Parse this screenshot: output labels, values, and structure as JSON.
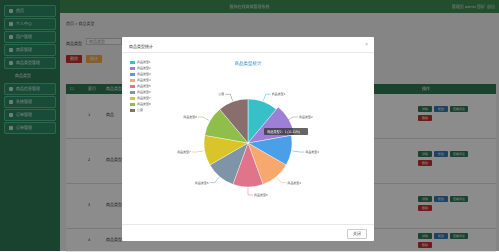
{
  "header": {
    "title": "服饰在线商城管理系统",
    "user_text": "管理员 admin 您好",
    "logout": "退出"
  },
  "sidebar": {
    "items": [
      {
        "label": "首页"
      },
      {
        "label": "个人中心"
      },
      {
        "label": "用户管理"
      },
      {
        "label": "商家管理"
      },
      {
        "label": "商品类型管理"
      },
      {
        "label": "商品类型"
      },
      {
        "label": "商品信息管理"
      },
      {
        "label": "系统管理"
      },
      {
        "label": "订单管理"
      },
      {
        "label": "订单管理"
      }
    ]
  },
  "main": {
    "breadcrumb": "首页 > 商品类型",
    "search_label": "商品类型",
    "search_placeholder": "商品类型",
    "buttons": {
      "search": "查询",
      "add": "新增",
      "delete": "删除",
      "stats": "统计"
    },
    "columns": {
      "index": "索引",
      "type": "商品类型",
      "action": "操作"
    },
    "rows": [
      {
        "num": "1",
        "name": "商品"
      },
      {
        "num": "2",
        "name": "商品类型2"
      },
      {
        "num": "3",
        "name": "商品类型3"
      },
      {
        "num": "4",
        "name": "商品类型4"
      }
    ],
    "row_actions": {
      "detail": "详情",
      "edit": "修改",
      "view": "查看评论",
      "delete": "删除"
    }
  },
  "modal": {
    "title": "商品类型统计",
    "close_icon": "×",
    "close_button": "关闭"
  },
  "chart_data": {
    "type": "pie",
    "title": "商品类型统计",
    "categories": [
      "商品类型1",
      "商品类型2",
      "商品类型3",
      "商品类型4",
      "商品类型5",
      "商品类型6",
      "商品类型7",
      "商品类型8",
      "公寓"
    ],
    "values": [
      1,
      1,
      1,
      1,
      1,
      1,
      1,
      1,
      1
    ],
    "tooltip": "商品类型2：1 (11.11%)",
    "colors": [
      "#37c0c8",
      "#9d7fd8",
      "#4a9fe8",
      "#f7a86f",
      "#e0748a",
      "#8094a8",
      "#d9c52a",
      "#8fbf4a",
      "#8a6e6e"
    ]
  }
}
